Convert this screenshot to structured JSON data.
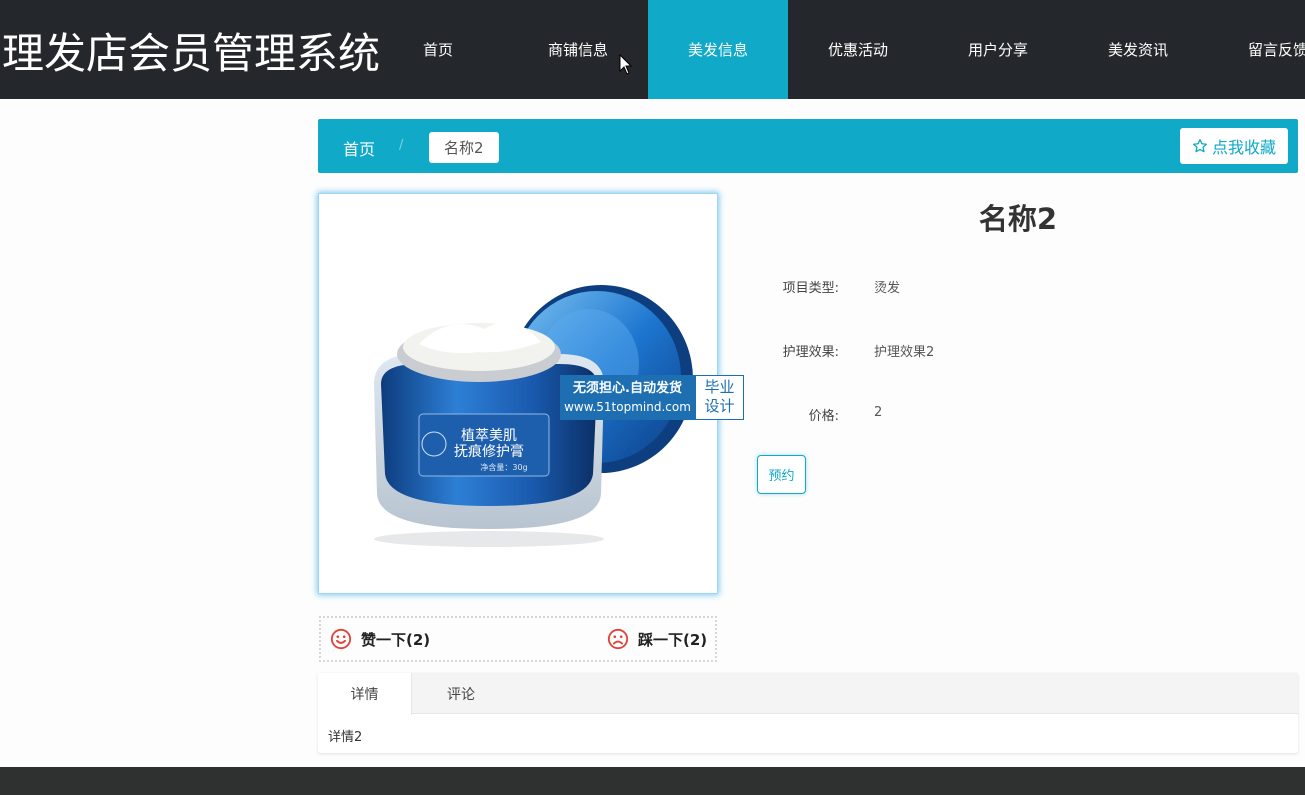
{
  "header": {
    "brand": "理发店会员管理系统",
    "nav": [
      {
        "label": "首页",
        "active": false
      },
      {
        "label": "商铺信息",
        "active": false
      },
      {
        "label": "美发信息",
        "active": true
      },
      {
        "label": "优惠活动",
        "active": false
      },
      {
        "label": "用户分享",
        "active": false
      },
      {
        "label": "美发资讯",
        "active": false
      },
      {
        "label": "留言反馈",
        "active": false
      }
    ]
  },
  "breadcrumb": {
    "home": "首页",
    "separator": "/",
    "current": "名称2"
  },
  "favorite": {
    "icon": "star-outline-icon",
    "label": "点我收藏"
  },
  "watermark": {
    "line1": "无须担心.自动发货",
    "line2": "www.51topmind.com",
    "badge1": "毕业",
    "badge2": "设计"
  },
  "product": {
    "image_texts": {
      "name_line1": "植萃美肌",
      "name_line2": "抚痕修护膏",
      "net_weight": "净含量：30g"
    },
    "title": "名称2",
    "fields": [
      {
        "label": "项目类型:",
        "value": "烫发"
      },
      {
        "label": "护理效果:",
        "value": "护理效果2"
      },
      {
        "label": "价格:",
        "value": "2"
      }
    ],
    "book_label": "预约"
  },
  "votes": {
    "like_label": "赞一下(2)",
    "dislike_label": "踩一下(2)"
  },
  "tabs": {
    "items": [
      {
        "label": "详情",
        "active": true
      },
      {
        "label": "评论",
        "active": false
      }
    ],
    "content": "详情2"
  },
  "colors": {
    "header_bg": "#24272c",
    "accent": "#10a9c7",
    "footer_bg": "#2f3030",
    "vote_icon": "#e0433b"
  }
}
